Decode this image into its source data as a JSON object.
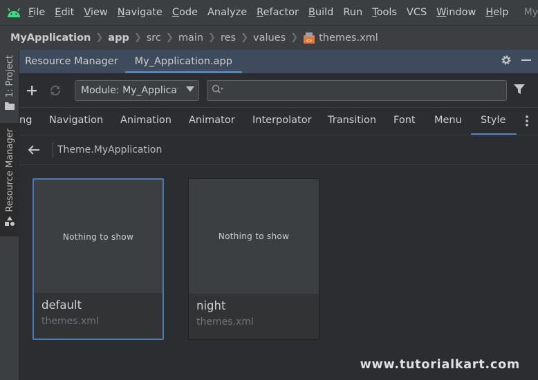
{
  "menubar": {
    "items": [
      {
        "label": "File",
        "mnemonic": "F",
        "rest": "ile"
      },
      {
        "label": "Edit",
        "mnemonic": "E",
        "rest": "dit"
      },
      {
        "label": "View",
        "mnemonic": "V",
        "rest": "iew"
      },
      {
        "label": "Navigate",
        "mnemonic": "N",
        "rest": "avigate"
      },
      {
        "label": "Code",
        "mnemonic": "C",
        "rest": "ode"
      },
      {
        "label": "Analyze",
        "mnemonic": "",
        "rest": "Analyze"
      },
      {
        "label": "Refactor",
        "mnemonic": "R",
        "rest": "efactor"
      },
      {
        "label": "Build",
        "mnemonic": "B",
        "rest": "uild"
      },
      {
        "label": "Run",
        "mnemonic": "",
        "rest": "Run"
      },
      {
        "label": "Tools",
        "mnemonic": "T",
        "rest": "ools"
      },
      {
        "label": "VCS",
        "mnemonic": "",
        "rest": "VCS"
      },
      {
        "label": "Window",
        "mnemonic": "W",
        "rest": "indow"
      },
      {
        "label": "Help",
        "mnemonic": "H",
        "rest": "elp"
      }
    ],
    "overflow": "My"
  },
  "breadcrumb": {
    "items": [
      "MyApplication",
      "app",
      "src",
      "main",
      "res",
      "values",
      "themes.xml"
    ]
  },
  "left_strip": {
    "project_tab": "1: Project",
    "resource_tab": "Resource Manager"
  },
  "tool_window": {
    "tabs": [
      "Resource Manager",
      "My_Application.app"
    ],
    "active_tab": 1
  },
  "toolbar": {
    "add_label": "+",
    "module_select": "Module: My_Application",
    "search_placeholder": ""
  },
  "categories": {
    "items": [
      "ng",
      "Navigation",
      "Animation",
      "Animator",
      "Interpolator",
      "Transition",
      "Font",
      "Menu",
      "Style"
    ],
    "active": "Style"
  },
  "pathbar": {
    "title": "Theme.MyApplication"
  },
  "cards": [
    {
      "preview": "Nothing to show",
      "name": "default",
      "file": "themes.xml",
      "selected": true
    },
    {
      "preview": "Nothing to show",
      "name": "night",
      "file": "themes.xml",
      "selected": false
    }
  ],
  "watermark": "www.tutorialkart.com",
  "colors": {
    "accent": "#4a88c7",
    "android_green": "#3ddc84",
    "header_blue": "#3d4b5c",
    "xml_orange": "#e07b39"
  }
}
